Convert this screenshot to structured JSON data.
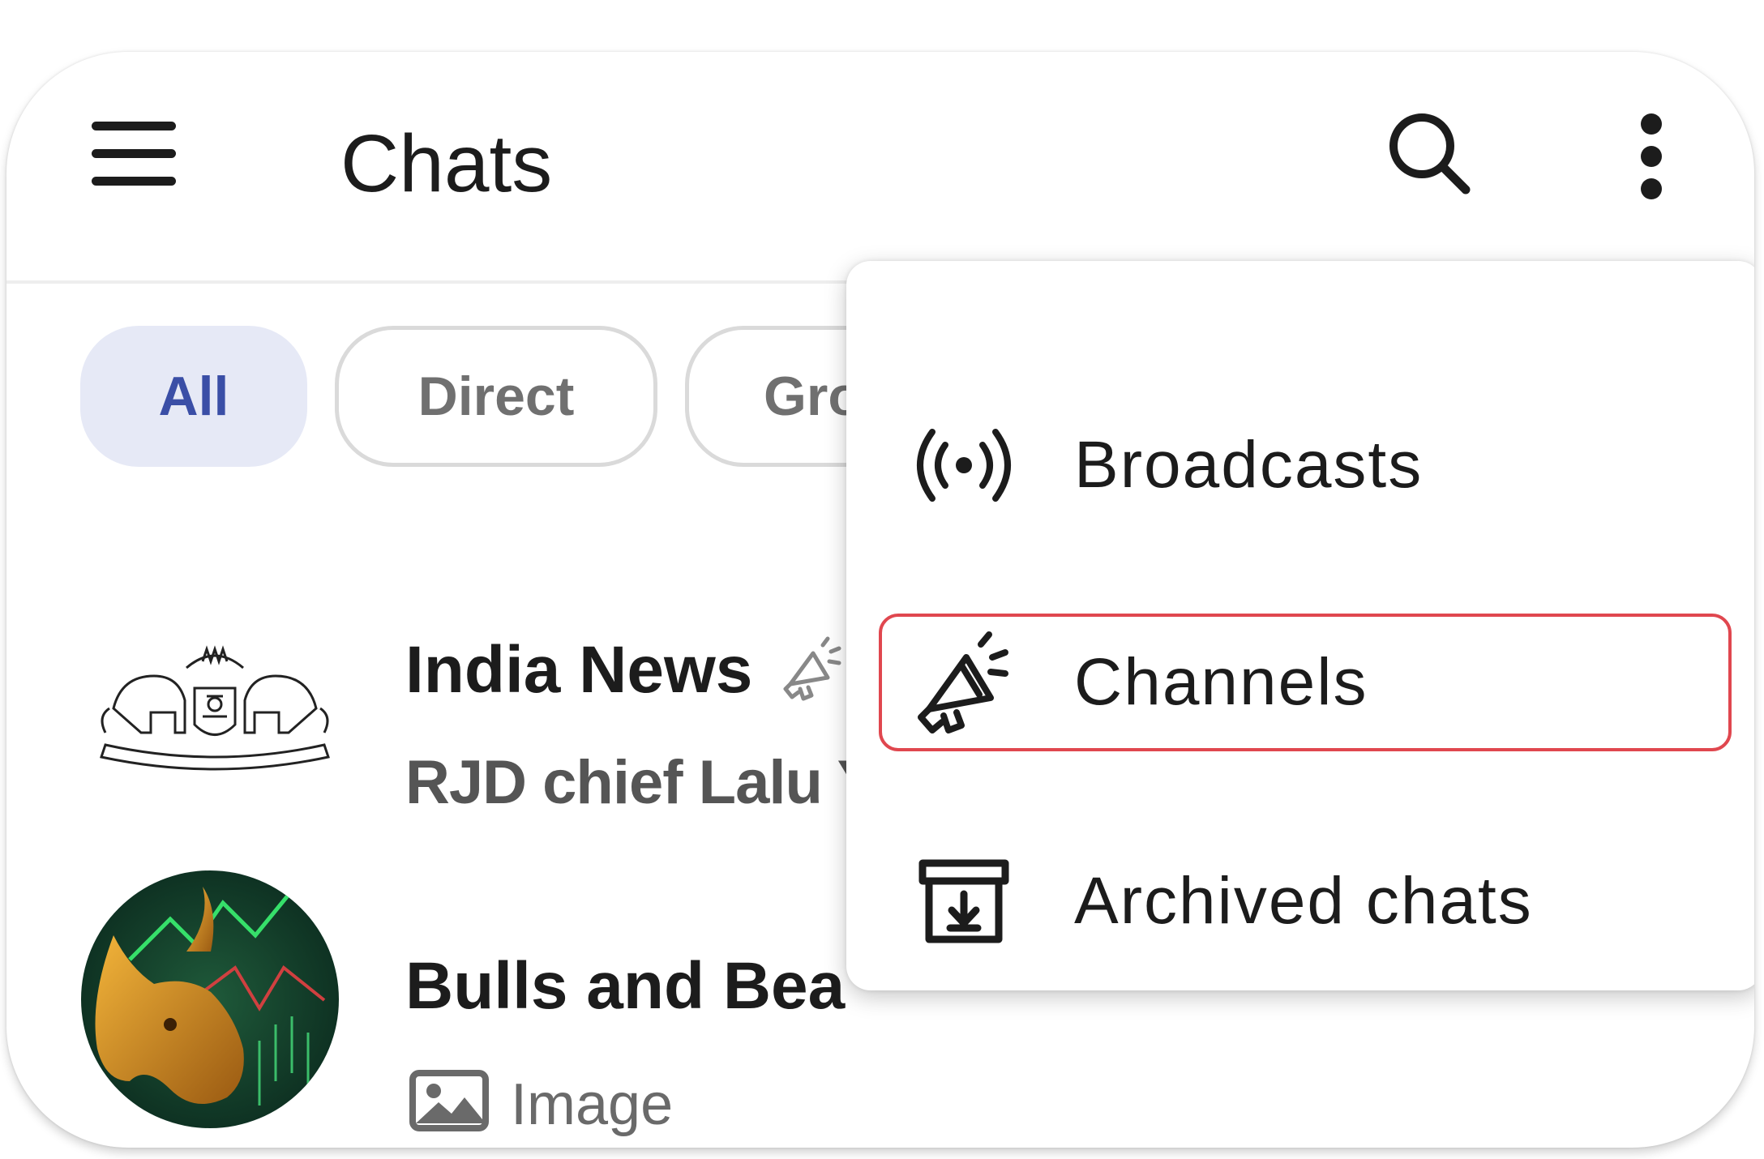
{
  "header": {
    "title": "Chats",
    "menu_icon": "hamburger-menu-icon",
    "search_icon": "search-icon",
    "more_icon": "more-vertical-icon"
  },
  "filters": [
    {
      "label": "All",
      "active": true
    },
    {
      "label": "Direct",
      "active": false
    },
    {
      "label": "Gro",
      "active": false
    }
  ],
  "chats": [
    {
      "name": "India News",
      "preview": "RJD chief Lalu Y",
      "badge_icon": "channel-megaphone-icon",
      "avatar": "emblem-logo-avatar"
    },
    {
      "name": "Bulls and Bea",
      "preview": "Image",
      "preview_icon": "image-icon",
      "avatar": "bull-chart-avatar"
    }
  ],
  "dropdown": {
    "items": [
      {
        "label": "Broadcasts",
        "icon": "broadcast-icon"
      },
      {
        "label": "Channels",
        "icon": "megaphone-icon",
        "highlighted": true
      },
      {
        "label": "Archived chats",
        "icon": "archive-icon"
      }
    ]
  },
  "colors": {
    "accent": "#3a4ea6",
    "chip_active_bg": "#e6e9f6",
    "highlight": "#e0474f"
  }
}
